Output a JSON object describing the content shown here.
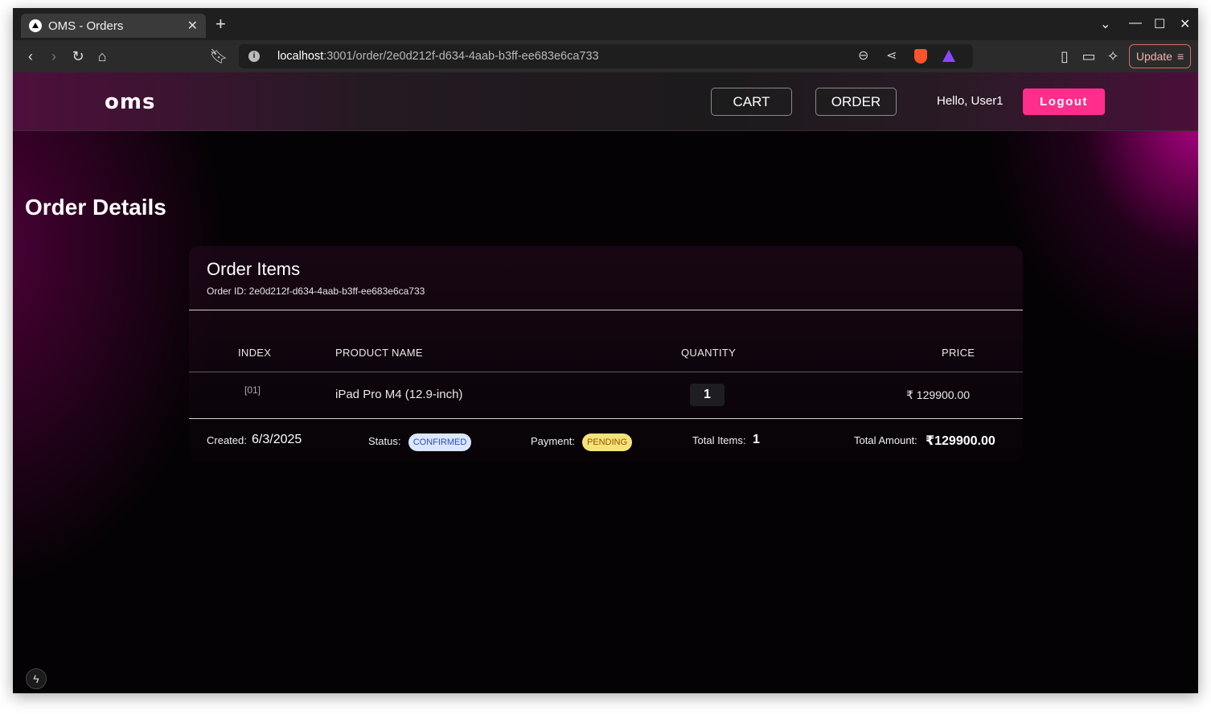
{
  "browser": {
    "tab_title": "OMS - Orders",
    "url_host": "localhost",
    "url_rest": ":3001/order/2e0d212f-d634-4aab-b3ff-ee683e6ca733",
    "update_label": "Update"
  },
  "navbar": {
    "logo": "oms",
    "cart_label": "CART",
    "order_label": "ORDER",
    "greeting": "Hello, User1",
    "logout_label": "Logout",
    "accent_color": "#ff2d8c"
  },
  "page": {
    "title": "Order Details"
  },
  "order_card": {
    "title": "Order Items",
    "order_id_text": "Order ID: 2e0d212f-d634-4aab-b3ff-ee683e6ca733",
    "columns": [
      "INDEX",
      "PRODUCT NAME",
      "QUANTITY",
      "PRICE"
    ],
    "rows": [
      {
        "index": "[01]",
        "product": "iPad Pro M4 (12.9-inch)",
        "quantity": "1",
        "price": "₹ 129900.00"
      }
    ],
    "footer": {
      "created_label": "Created:",
      "created_value": "6/3/2025",
      "status_label": "Status:",
      "status_value": "CONFIRMED",
      "payment_label": "Payment:",
      "payment_value": "PENDING",
      "total_items_label": "Total Items:",
      "total_items_value": "1",
      "total_amount_label": "Total Amount:",
      "total_amount_value": "₹129900.00"
    }
  }
}
